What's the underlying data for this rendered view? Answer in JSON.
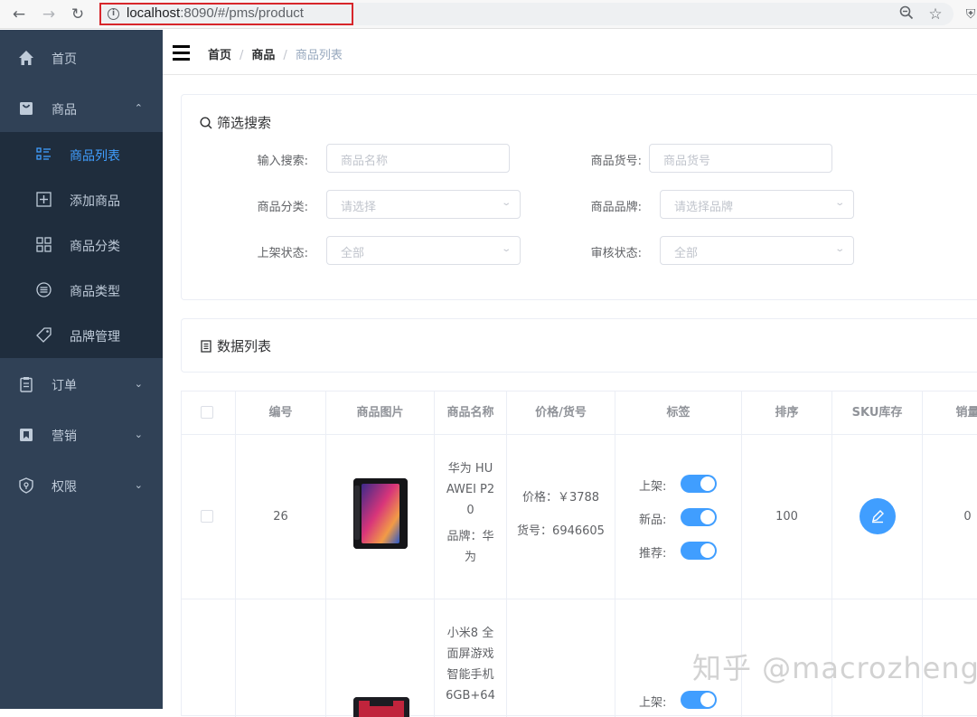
{
  "browser": {
    "url_host": "localhost",
    "url_rest": ":8090/#/pms/product"
  },
  "sidebar": {
    "home": "首页",
    "product": "商品",
    "sub": [
      {
        "label": "商品列表",
        "icon": "list-icon",
        "active": true
      },
      {
        "label": "添加商品",
        "icon": "add-square-icon",
        "active": false
      },
      {
        "label": "商品分类",
        "icon": "grid-icon",
        "active": false
      },
      {
        "label": "商品类型",
        "icon": "list-circle-icon",
        "active": false
      },
      {
        "label": "品牌管理",
        "icon": "tag-icon",
        "active": false
      }
    ],
    "order": "订单",
    "marketing": "营销",
    "permission": "权限"
  },
  "breadcrumb": {
    "home": "首页",
    "product": "商品",
    "current": "商品列表"
  },
  "filter": {
    "title": "筛选搜索",
    "keyword_label": "输入搜索:",
    "keyword_placeholder": "商品名称",
    "sn_label": "商品货号:",
    "sn_placeholder": "商品货号",
    "category_label": "商品分类:",
    "category_placeholder": "请选择",
    "brand_label": "商品品牌:",
    "brand_placeholder": "请选择品牌",
    "publish_label": "上架状态:",
    "publish_value": "全部",
    "verify_label": "审核状态:",
    "verify_value": "全部"
  },
  "list": {
    "title": "数据列表"
  },
  "table": {
    "headers": [
      "编号",
      "商品图片",
      "商品名称",
      "价格/货号",
      "标签",
      "排序",
      "SKU库存",
      "销量"
    ],
    "rows": [
      {
        "id": "26",
        "name_lines": [
          "华为 HU",
          "AWEI P2",
          "0"
        ],
        "brand_lines": [
          "品牌：华",
          "为"
        ],
        "price": "价格：￥3788",
        "sn": "货号：6946605",
        "tag_publish": "上架:",
        "tag_new": "新品:",
        "tag_recommend": "推荐:",
        "sort": "100",
        "sales": "0"
      },
      {
        "name_lines": [
          "小米8 全",
          "面屏游戏",
          "智能手机",
          "6GB+64"
        ],
        "tag_publish": "上架:"
      }
    ]
  },
  "watermark": "知乎 @macrozheng",
  "colors": {
    "sidebar_bg": "#304156",
    "submenu_bg": "#1f2d3d",
    "accent": "#409eff",
    "url_highlight": "#d7262b"
  }
}
